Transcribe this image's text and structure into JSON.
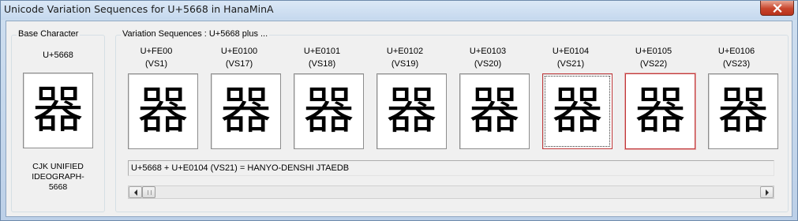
{
  "window": {
    "title": "Unicode Variation Sequences for U+5668 in HanaMinA"
  },
  "base": {
    "legend": "Base Character",
    "code": "U+5668",
    "glyph": "器",
    "name_line1": "CJK UNIFIED",
    "name_line2": "IDEOGRAPH-",
    "name_line3": "5668"
  },
  "variations": {
    "legend": "Variation Sequences : U+5668 plus ...",
    "items": [
      {
        "code": "U+FE00",
        "label": "(VS1)",
        "glyph": "器"
      },
      {
        "code": "U+E0100",
        "label": "(VS17)",
        "glyph": "器"
      },
      {
        "code": "U+E0101",
        "label": "(VS18)",
        "glyph": "器"
      },
      {
        "code": "U+E0102",
        "label": "(VS19)",
        "glyph": "器"
      },
      {
        "code": "U+E0103",
        "label": "(VS20)",
        "glyph": "器"
      },
      {
        "code": "U+E0104",
        "label": "(VS21)",
        "glyph": "器"
      },
      {
        "code": "U+E0105",
        "label": "(VS22)",
        "glyph": "器"
      },
      {
        "code": "U+E0106",
        "label": "(VS23)",
        "glyph": "器"
      }
    ],
    "selected_index": 5,
    "info": "U+5668 + U+E0104 (VS21) = HANYO-DENSHI JTAEDB"
  },
  "colors": {
    "selection": "#c0393b",
    "close_button": "#c8452c"
  },
  "icons": {
    "close": "close-icon",
    "scroll_left": "arrow-left-icon",
    "scroll_right": "arrow-right-icon"
  }
}
